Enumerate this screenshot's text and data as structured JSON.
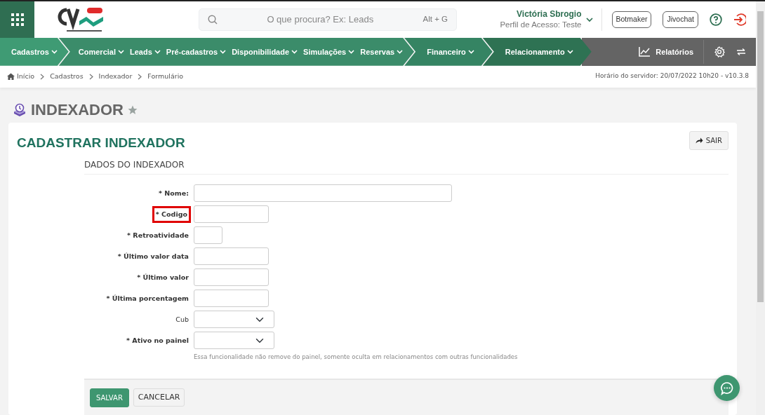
{
  "header": {
    "search": {
      "placeholder": "O que procura? Ex: Leads",
      "shortcut": "Alt + G"
    },
    "user": {
      "name": "Victória Sbrogio",
      "profile": "Perfil de Acesso: Teste"
    },
    "buttons": [
      "Botmaker",
      "Jivochat"
    ]
  },
  "nav": {
    "groups": [
      {
        "color": "#3f9b74",
        "items": [
          "Cadastros"
        ]
      },
      {
        "color": "#3b8c6a",
        "items": [
          "Comercial",
          "Leads",
          "Pré-cadastros",
          "Disponibilidade",
          "Simulações",
          "Reservas"
        ]
      },
      {
        "color": "#358463",
        "items": [
          "Financeiro"
        ]
      },
      {
        "color": "#2e7253",
        "items": [
          "Relacionamento"
        ]
      }
    ],
    "reports": "Relatórios"
  },
  "breadcrumb": [
    "Início",
    "Cadastros",
    "Indexador",
    "Formulário"
  ],
  "server_time": "Horário do servidor: 20/07/2022 10h20 - v10.3.8",
  "page_title": "INDEXADOR",
  "form": {
    "title": "CADASTRAR INDEXADOR",
    "exit_button": "SAIR",
    "section": "DADOS DO INDEXADOR",
    "fields": [
      {
        "label": "* Nome:",
        "required": true,
        "highlighted": false,
        "kind": "longtext"
      },
      {
        "label": "* Codigo",
        "required": true,
        "highlighted": true,
        "kind": "text"
      },
      {
        "label": "* Retroatividade",
        "required": true,
        "highlighted": false,
        "kind": "shorttext"
      },
      {
        "label": "* Último valor data",
        "required": true,
        "highlighted": false,
        "kind": "text"
      },
      {
        "label": "* Último valor",
        "required": true,
        "highlighted": false,
        "kind": "text"
      },
      {
        "label": "* Última porcentagem",
        "required": true,
        "highlighted": false,
        "kind": "text"
      },
      {
        "label": "Cub",
        "required": false,
        "highlighted": false,
        "kind": "select"
      },
      {
        "label": "* Ativo no painel",
        "required": true,
        "highlighted": false,
        "kind": "select",
        "help": "Essa funcionalidade não remove do painel, somente oculta em relacionamentos com outras funcionalidades"
      }
    ],
    "buttons": [
      {
        "label": "SALVAR",
        "kind": "primary"
      },
      {
        "label": "CANCELAR",
        "kind": "secondary"
      }
    ]
  }
}
